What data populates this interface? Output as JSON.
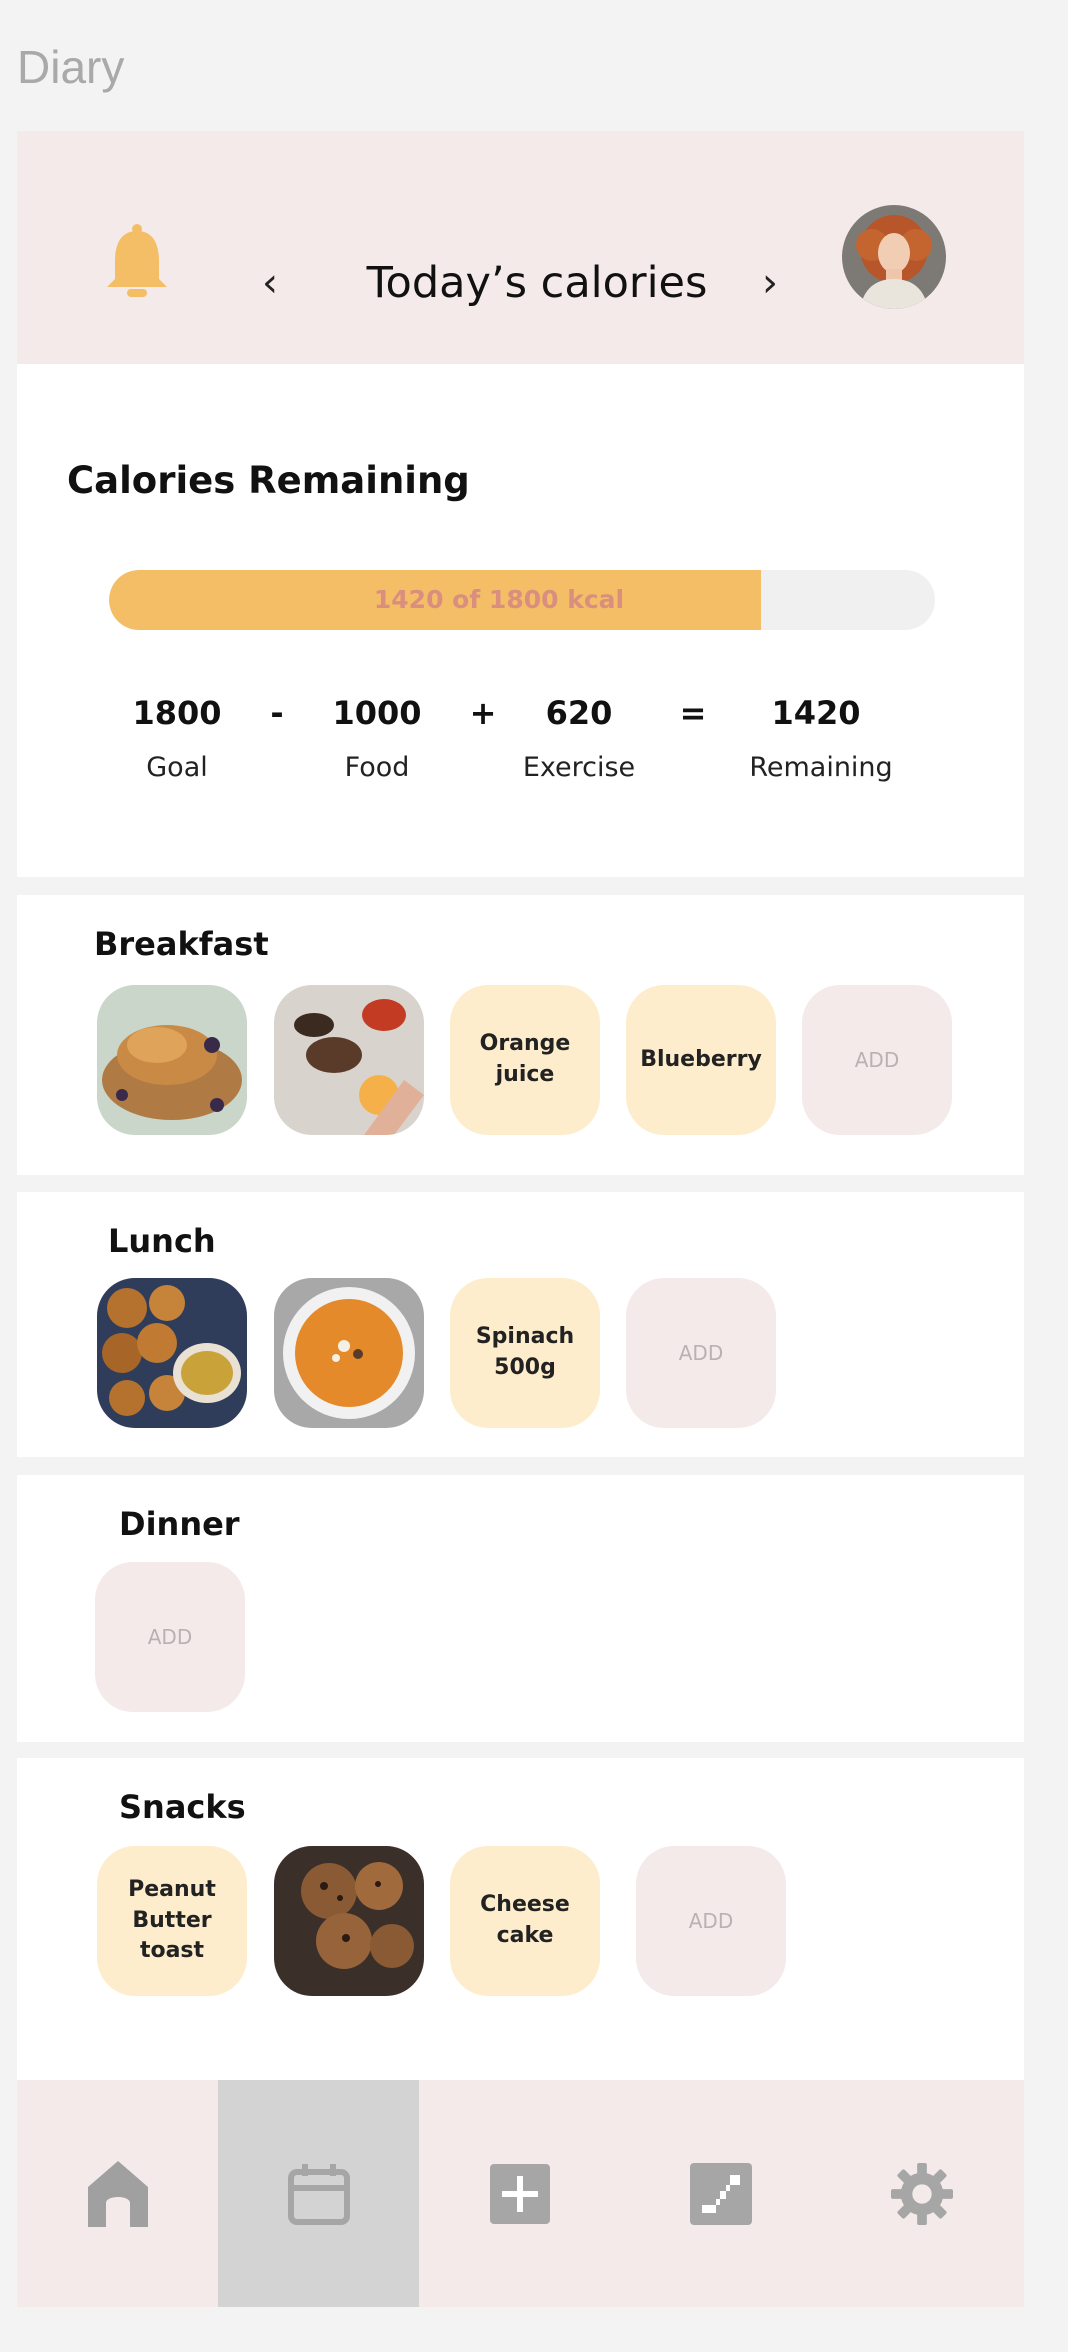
{
  "page": {
    "label": "Diary"
  },
  "header": {
    "title": "Today’s calories",
    "prev": "‹",
    "next": "›",
    "bell_icon": "bell-icon",
    "accent": "#f4be66"
  },
  "summary": {
    "title": "Calories Remaining",
    "progress_text": "1420 of 1800 kcal",
    "progress_fraction": 0.7889,
    "equation": {
      "goal_value": "1800",
      "goal_label": "Goal",
      "op1": "-",
      "food_value": "1000",
      "food_label": "Food",
      "op2": "+",
      "exercise_value": "620",
      "exercise_label": "Exercise",
      "op3": "=",
      "remaining_value": "1420",
      "remaining_label": "Remaining"
    }
  },
  "meals": {
    "breakfast": {
      "title": "Breakfast",
      "items": [
        "Orange juice",
        "Blueberry"
      ],
      "add": "ADD"
    },
    "lunch": {
      "title": "Lunch",
      "items": [
        "Spinach 500g"
      ],
      "add": "ADD"
    },
    "dinner": {
      "title": "Dinner",
      "add": "ADD"
    },
    "snacks": {
      "title": "Snacks",
      "items": [
        "Peanut Butter toast",
        "Cheese cake"
      ],
      "add": "ADD"
    }
  },
  "bottom_nav": {
    "items": [
      "home-icon",
      "calendar-icon",
      "add-icon",
      "progress-icon",
      "gear-icon"
    ],
    "active": "calendar-icon"
  }
}
